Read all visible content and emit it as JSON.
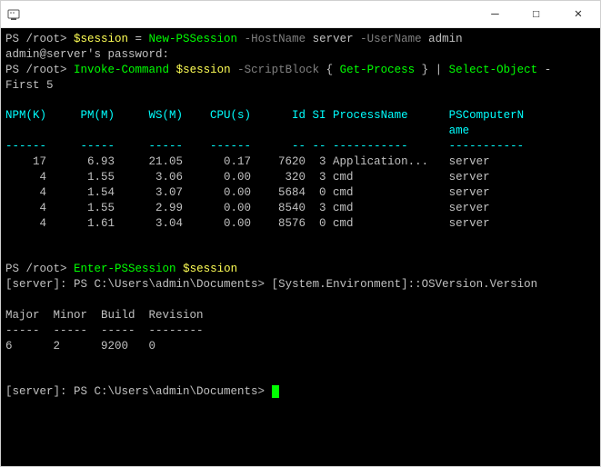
{
  "titlebar": {
    "icon_name": "terminal-app-icon",
    "glyph_minimize": "—",
    "glyph_maximize": "☐",
    "glyph_close": "✕"
  },
  "line1": {
    "prompt": "PS /root> ",
    "var": "$session",
    "eq": " = ",
    "cmd": "New-PSSession",
    "flag_host": " -HostName ",
    "host_val": "server",
    "flag_user": " -UserName ",
    "user_val": "admin"
  },
  "line2": "admin@server's password:",
  "line3": {
    "prompt": "PS /root> ",
    "cmd": "Invoke-Command",
    "sp1": " ",
    "var": "$session",
    "flag_sb": " -ScriptBlock ",
    "lb": "{ ",
    "inner": "Get-Process",
    "rb": " } ",
    "pipe": "| ",
    "sel": "Select-Object",
    "dash": " -"
  },
  "line4": {
    "flag": "First ",
    "num": "5"
  },
  "table1": {
    "headers": [
      "NPM(K)",
      "PM(M)",
      "WS(M)",
      "CPU(s)",
      "Id",
      "SI",
      "ProcessName",
      "PSComputerName"
    ],
    "divider": "------",
    "rows": [
      {
        "npm": "17",
        "pm": "6.93",
        "ws": "21.05",
        "cpu": "0.17",
        "id": "7620",
        "si": "3",
        "name": "Application...",
        "comp": "server"
      },
      {
        "npm": "4",
        "pm": "1.55",
        "ws": "3.06",
        "cpu": "0.00",
        "id": "320",
        "si": "3",
        "name": "cmd",
        "comp": "server"
      },
      {
        "npm": "4",
        "pm": "1.54",
        "ws": "3.07",
        "cpu": "0.00",
        "id": "5684",
        "si": "0",
        "name": "cmd",
        "comp": "server"
      },
      {
        "npm": "4",
        "pm": "1.55",
        "ws": "2.99",
        "cpu": "0.00",
        "id": "8540",
        "si": "3",
        "name": "cmd",
        "comp": "server"
      },
      {
        "npm": "4",
        "pm": "1.61",
        "ws": "3.04",
        "cpu": "0.00",
        "id": "8576",
        "si": "0",
        "name": "cmd",
        "comp": "server"
      }
    ]
  },
  "line5": {
    "prompt": "PS /root> ",
    "cmd": "Enter-PSSession",
    "sp": " ",
    "var": "$session"
  },
  "line6": {
    "left": "[server]: PS C:\\Users\\admin\\Documents> ",
    "right": "[System.Environment]::OSVersion.Version"
  },
  "table2": {
    "headers": [
      "Major",
      "Minor",
      "Build",
      "Revision"
    ],
    "divider": "-----",
    "row": {
      "major": "6",
      "minor": "2",
      "build": "9200",
      "revision": "0"
    }
  },
  "line7": {
    "text": "[server]: PS C:\\Users\\admin\\Documents> "
  }
}
